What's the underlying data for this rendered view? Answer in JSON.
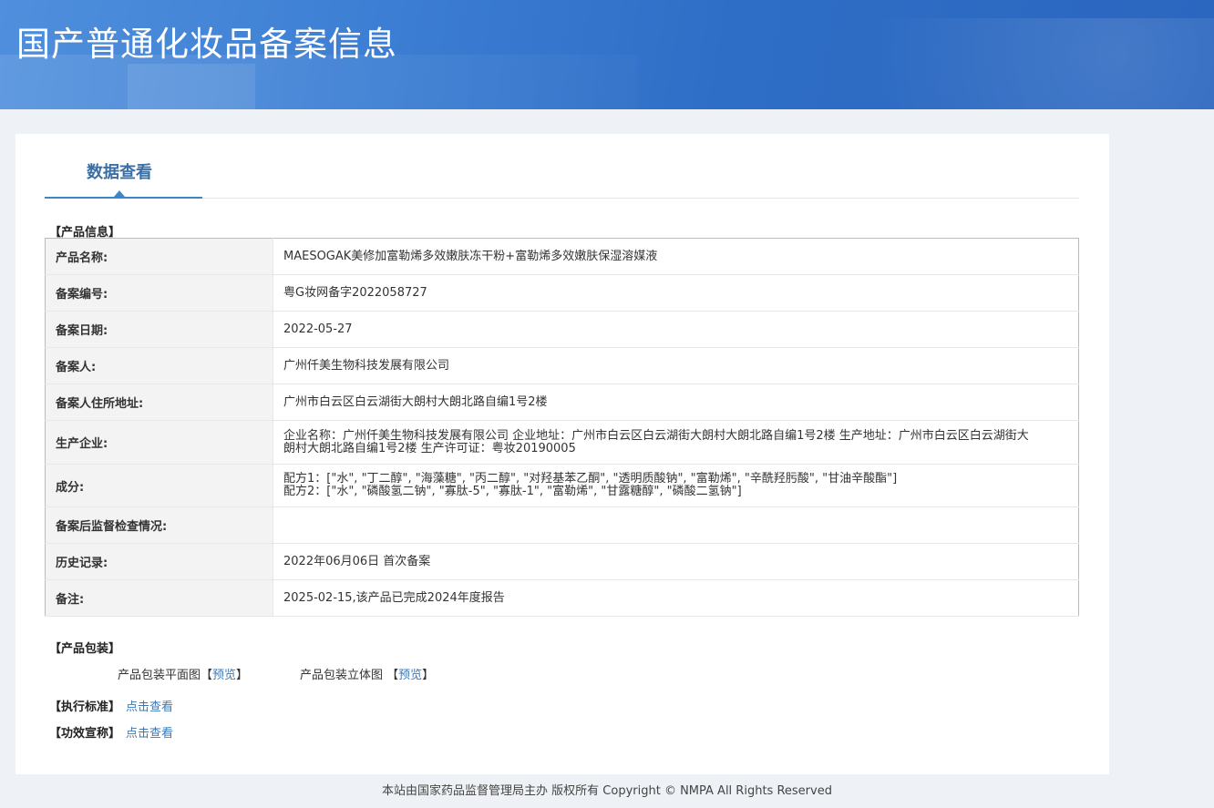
{
  "header": {
    "title": "国产普通化妆品备案信息"
  },
  "tab": {
    "label": "数据查看"
  },
  "sections": {
    "product_info": "【产品信息】",
    "packaging": "【产品包装】",
    "standard": "【执行标准】",
    "efficacy": "【功效宣称】"
  },
  "info_rows": [
    {
      "label": "产品名称:",
      "value": "MAESOGAK美修加富勒烯多效嫩肤冻干粉+富勒烯多效嫩肤保湿溶媒液"
    },
    {
      "label": "备案编号:",
      "value": "粤G妆网备字2022058727"
    },
    {
      "label": "备案日期:",
      "value": "2022-05-27"
    },
    {
      "label": "备案人:",
      "value": "广州仟美生物科技发展有限公司"
    },
    {
      "label": "备案人住所地址:",
      "value": "广州市白云区白云湖街大朗村大朗北路自编1号2楼"
    },
    {
      "label": "生产企业:",
      "value": "企业名称：广州仟美生物科技发展有限公司 企业地址：广州市白云区白云湖街大朗村大朗北路自编1号2楼 生产地址：广州市白云区白云湖街大朗村大朗北路自编1号2楼 生产许可证：粤妆20190005"
    },
    {
      "label": "成分:",
      "value_lines": [
        "配方1：[\"水\", \"丁二醇\", \"海藻糖\", \"丙二醇\", \"对羟基苯乙酮\", \"透明质酸钠\", \"富勒烯\", \"辛酰羟肟酸\", \"甘油辛酸酯\"]",
        "配方2：[\"水\", \"磷酸氢二钠\", \"寡肽-5\", \"寡肽-1\", \"富勒烯\", \"甘露糖醇\", \"磷酸二氢钠\"]"
      ]
    },
    {
      "label": "备案后监督检查情况:",
      "value": ""
    },
    {
      "label": "历史记录:",
      "value": "2022年06月06日 首次备案"
    },
    {
      "label": "备注:",
      "value": "2025-02-15,该产品已完成2024年度报告"
    }
  ],
  "packaging": {
    "flat_label": "产品包装平面图",
    "flat_link": "预览",
    "solid_label": "产品包装立体图",
    "solid_link": "预览"
  },
  "links": {
    "standard_link": "点击查看",
    "efficacy_link": "点击查看"
  },
  "footer": {
    "text": "本站由国家药品监督管理局主办 版权所有 Copyright © NMPA All Rights Reserved"
  }
}
